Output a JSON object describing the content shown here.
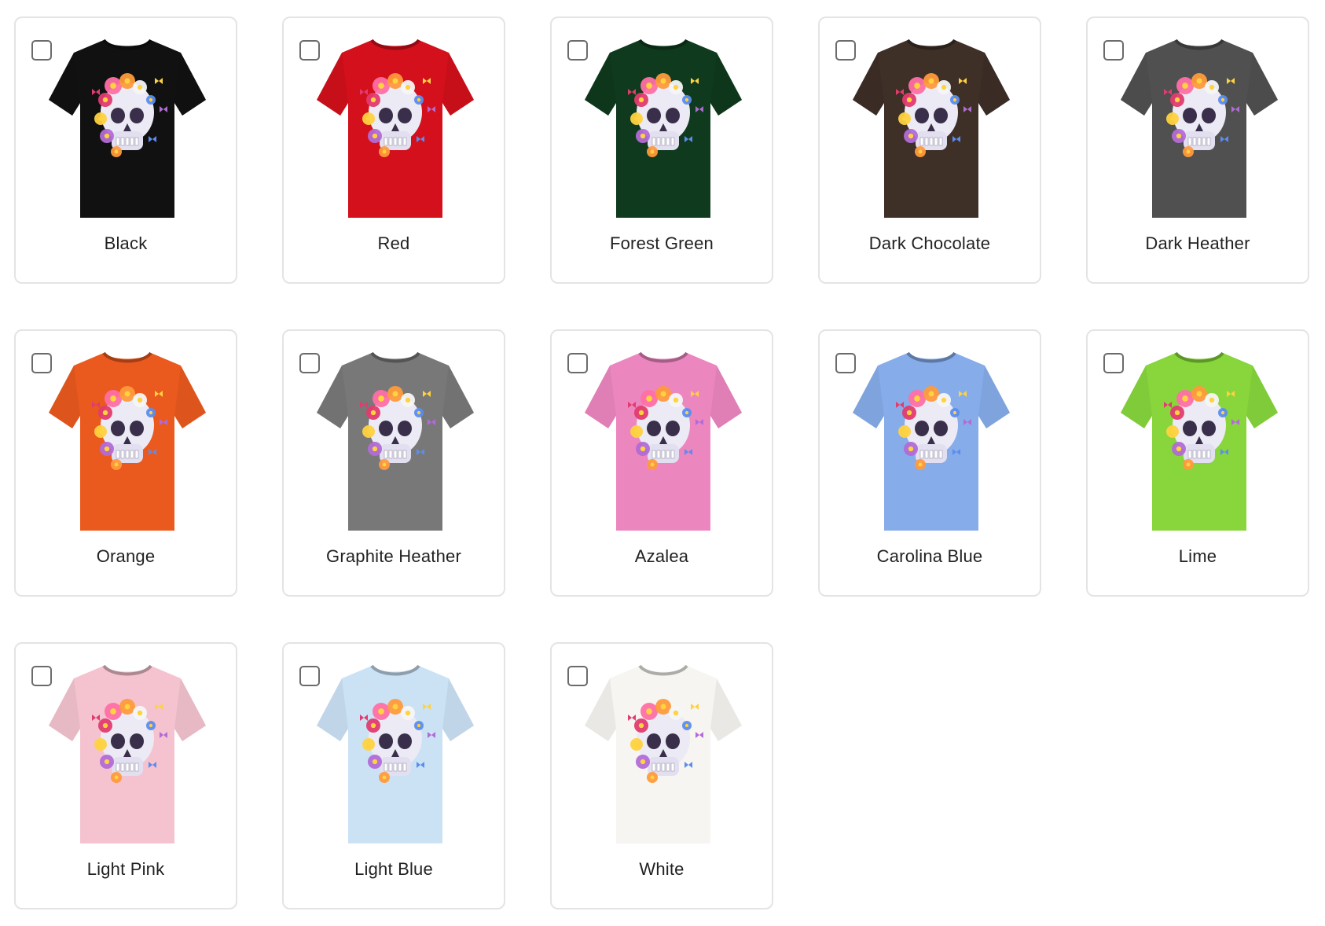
{
  "colors": [
    {
      "label": "Black",
      "hex": "#111111"
    },
    {
      "label": "Red",
      "hex": "#d3101b"
    },
    {
      "label": "Forest Green",
      "hex": "#0f3a1d"
    },
    {
      "label": "Dark Chocolate",
      "hex": "#3e2f27"
    },
    {
      "label": "Dark Heather",
      "hex": "#505050"
    },
    {
      "label": "Orange",
      "hex": "#ea5a1e"
    },
    {
      "label": "Graphite Heather",
      "hex": "#787878"
    },
    {
      "label": "Azalea",
      "hex": "#ec86bf"
    },
    {
      "label": "Carolina Blue",
      "hex": "#86acea"
    },
    {
      "label": "Lime",
      "hex": "#88d63c"
    },
    {
      "label": "Light Pink",
      "hex": "#f4c3cf"
    },
    {
      "label": "Light Blue",
      "hex": "#cbe2f5"
    },
    {
      "label": "White",
      "hex": "#f6f5f1"
    }
  ],
  "design": {
    "icon": "floral-skull-butterflies",
    "palette": [
      "#ff6fa5",
      "#ff9a3c",
      "#ffd23f",
      "#b26bd6",
      "#5b8def",
      "#e23b6f",
      "#f5f5f5"
    ]
  }
}
